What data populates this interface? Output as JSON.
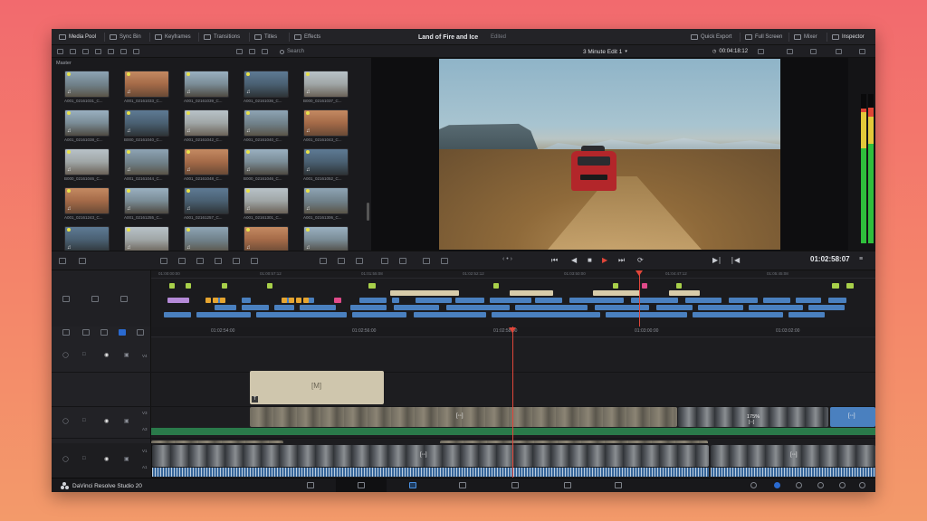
{
  "toolbar": {
    "media_pool": "Media Pool",
    "sync_bin": "Sync Bin",
    "keyframes": "Keyframes",
    "transitions": "Transitions",
    "titles": "Titles",
    "effects": "Effects",
    "project_title": "Land of Fire and Ice",
    "project_status": "Edited",
    "quick_export": "Quick Export",
    "full_screen": "Full Screen",
    "mixer": "Mixer",
    "inspector": "Inspector"
  },
  "subbar": {
    "search_placeholder": "Search",
    "timeline_name": "3 Minute Edit 1",
    "timecode": "00:04:18:12"
  },
  "media_pool": {
    "bin_name": "Master",
    "clips": [
      "A001_02161031_C...",
      "A001_02161033_C...",
      "A001_02161039_C...",
      "A001_02161036_C...",
      "B000_02161037_C...",
      "A001_02161038_C...",
      "B000_02161040_C...",
      "A001_02161042_C...",
      "A001_02161040_C...",
      "A001_02161043_C...",
      "B000_02161046_C...",
      "A001_02161044_C...",
      "A001_02161048_C...",
      "B000_02161046_C...",
      "A001_02161052_C...",
      "A001_02161243_C...",
      "A001_02161255_C...",
      "A001_02161257_C...",
      "A001_02161301_C...",
      "A001_02161306_C...",
      "A001_02161310_C...",
      "A001_02161315_C...",
      "A001_02161320_C...",
      "A001_02161322_C...",
      "A001_02161330_C..."
    ]
  },
  "transport": {
    "timecode": "01:02:58:07",
    "jog": "‹ • ›"
  },
  "mini_ruler": [
    "01:00:00:00",
    "01:00:57:12",
    "01:01:55:08",
    "01:02:52:12",
    "01:03:50:00",
    "01:04:47:12",
    "01:05:45:08"
  ],
  "main_ruler": [
    "01:02:54:00",
    "01:02:56:00",
    "01:02:58:00",
    "01:03:00:00",
    "01:03:02:00"
  ],
  "tracks": {
    "v4": "V4",
    "v3": "V3",
    "a3": "A3",
    "v2": "V2",
    "a2": "A2",
    "v1": "V1",
    "a1": "A1"
  },
  "clips": {
    "title_marker": "[M]",
    "title_badge": "T",
    "fx_marker": "[◦◦]",
    "speed": "175%"
  },
  "footer": {
    "brand": "DaVinci Resolve Studio 20"
  },
  "colors": {
    "accent_red": "#e0463a",
    "clip_blue": "#4a80bf",
    "title_beige": "#cfc6ad"
  }
}
